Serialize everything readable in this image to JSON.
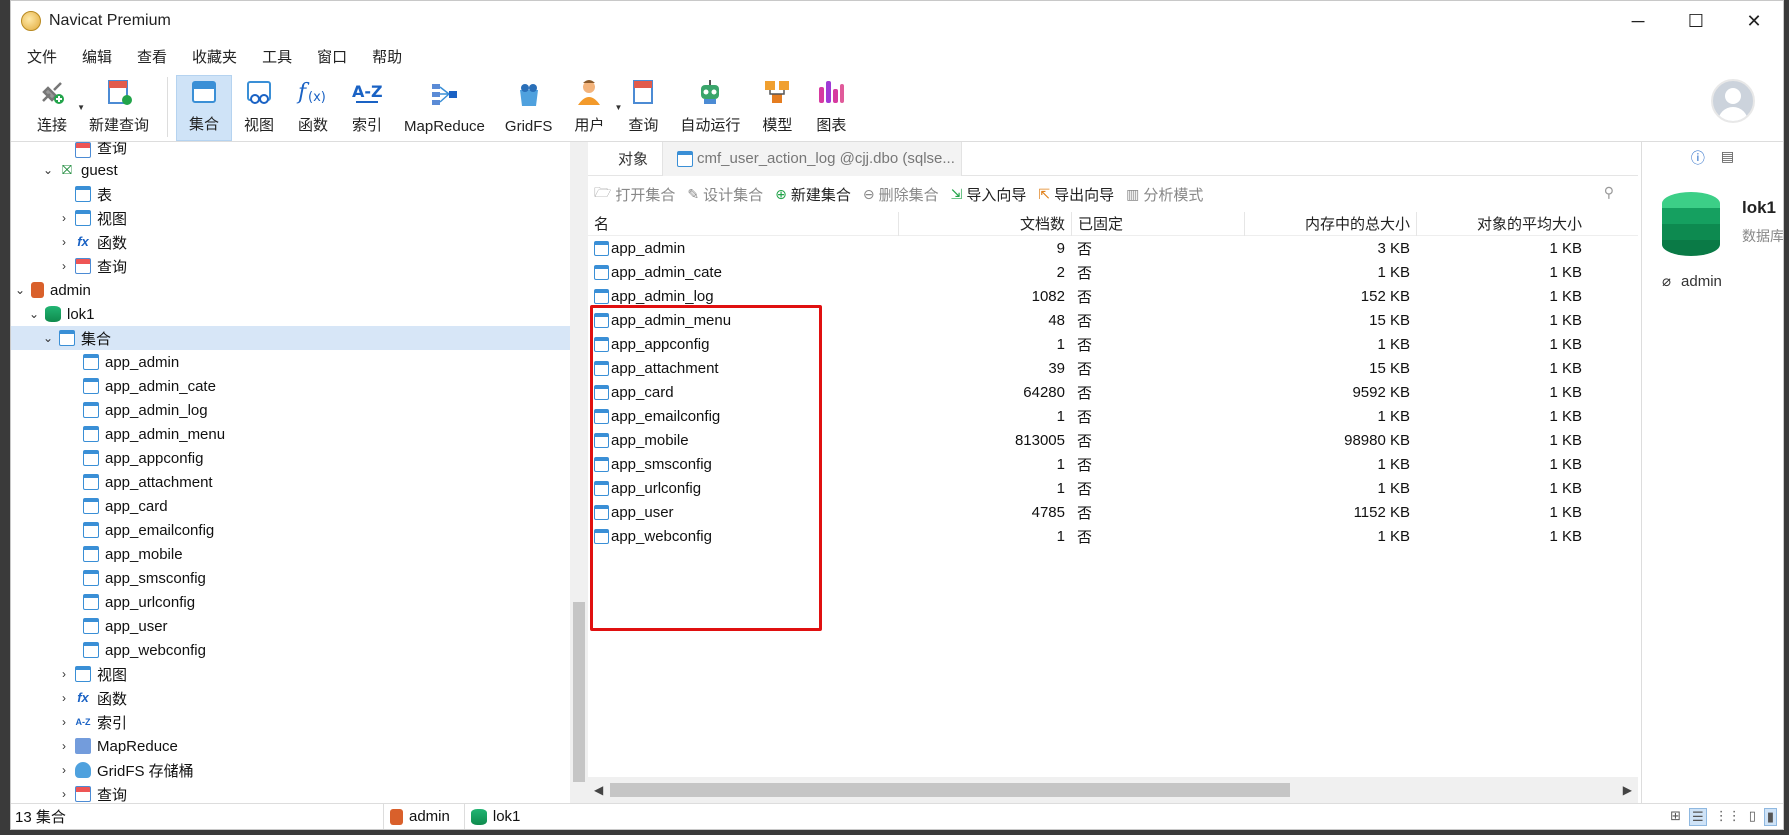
{
  "window": {
    "title": "Navicat Premium"
  },
  "menu": [
    "文件",
    "编辑",
    "查看",
    "收藏夹",
    "工具",
    "窗口",
    "帮助"
  ],
  "toolbar": {
    "connect": "连接",
    "new_query": "新建查询",
    "collection": "集合",
    "view": "视图",
    "function": "函数",
    "index": "索引",
    "mapreduce": "MapReduce",
    "gridfs": "GridFS",
    "user": "用户",
    "query": "查询",
    "automation": "自动运行",
    "model": "模型",
    "chart": "图表"
  },
  "tree": {
    "partial_query": "查询",
    "guest": "guest",
    "guest_children": [
      "表",
      "视图",
      "函数",
      "查询"
    ],
    "admin": "admin",
    "db": "lok1",
    "collections_folder": "集合",
    "collections": [
      "app_admin",
      "app_admin_cate",
      "app_admin_log",
      "app_admin_menu",
      "app_appconfig",
      "app_attachment",
      "app_card",
      "app_emailconfig",
      "app_mobile",
      "app_smsconfig",
      "app_urlconfig",
      "app_user",
      "app_webconfig"
    ],
    "other_folders": [
      "视图",
      "函数",
      "索引",
      "MapReduce",
      "GridFS 存储桶",
      "查询"
    ]
  },
  "tabs": {
    "objects": "对象",
    "query_tab": "cmf_user_action_log @cjj.dbo (sqlse..."
  },
  "subtoolbar": {
    "open": "打开集合",
    "design": "设计集合",
    "new": "新建集合",
    "delete": "删除集合",
    "import": "导入向导",
    "export": "导出向导",
    "analyze": "分析模式"
  },
  "grid": {
    "headers": [
      "名",
      "文档数",
      "已固定",
      "内存中的总大小",
      "对象的平均大小"
    ],
    "rows": [
      [
        "app_admin",
        "9",
        "否",
        "3 KB",
        "1 KB"
      ],
      [
        "app_admin_cate",
        "2",
        "否",
        "1 KB",
        "1 KB"
      ],
      [
        "app_admin_log",
        "1082",
        "否",
        "152 KB",
        "1 KB"
      ],
      [
        "app_admin_menu",
        "48",
        "否",
        "15 KB",
        "1 KB"
      ],
      [
        "app_appconfig",
        "1",
        "否",
        "1 KB",
        "1 KB"
      ],
      [
        "app_attachment",
        "39",
        "否",
        "15 KB",
        "1 KB"
      ],
      [
        "app_card",
        "64280",
        "否",
        "9592 KB",
        "1 KB"
      ],
      [
        "app_emailconfig",
        "1",
        "否",
        "1 KB",
        "1 KB"
      ],
      [
        "app_mobile",
        "813005",
        "否",
        "98980 KB",
        "1 KB"
      ],
      [
        "app_smsconfig",
        "1",
        "否",
        "1 KB",
        "1 KB"
      ],
      [
        "app_urlconfig",
        "1",
        "否",
        "1 KB",
        "1 KB"
      ],
      [
        "app_user",
        "4785",
        "否",
        "1152 KB",
        "1 KB"
      ],
      [
        "app_webconfig",
        "1",
        "否",
        "1 KB",
        "1 KB"
      ]
    ]
  },
  "rpanel": {
    "name": "lok1",
    "sub": "数据库",
    "owner": "admin"
  },
  "status": {
    "count": "13 集合",
    "conn": "admin",
    "db": "lok1"
  },
  "colors": {
    "accent": "#3a8fd6",
    "selection": "#d7e6f7",
    "highlight_box": "#e01010"
  }
}
